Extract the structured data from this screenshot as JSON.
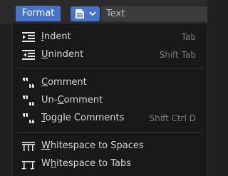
{
  "header": {
    "format_tab": "Format",
    "text_label": "Text"
  },
  "menu": {
    "items": [
      {
        "label": "Indent",
        "shortcut": "Tab",
        "icon": "indent-icon"
      },
      {
        "label": "Unindent",
        "shortcut": "Shift Tab",
        "icon": "unindent-icon"
      },
      {
        "label": "Comment",
        "shortcut": "",
        "icon": "comment-icon"
      },
      {
        "label": "Un-Comment",
        "shortcut": "",
        "icon": "uncomment-icon"
      },
      {
        "label": "Toggle Comments",
        "shortcut": "Shift Ctrl D",
        "icon": "toggle-comment-icon"
      },
      {
        "label": "Whitespace to Spaces",
        "shortcut": "",
        "icon": "whitespace-spaces-icon"
      },
      {
        "label": "Whitespace to Tabs",
        "shortcut": "",
        "icon": "whitespace-tabs-icon"
      }
    ]
  },
  "colors": {
    "accent": "#4773c8",
    "menu_bg": "#181818",
    "text": "#d6d6d6",
    "shortcut": "#7d7d7d"
  }
}
